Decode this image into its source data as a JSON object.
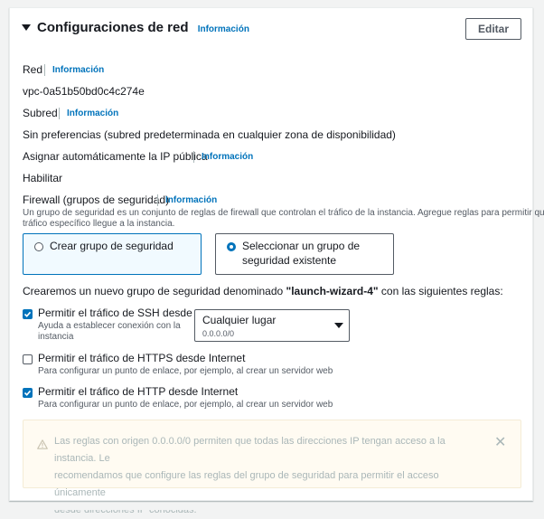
{
  "header": {
    "title": "Configuraciones de red",
    "info": "Información",
    "edit_button": "Editar"
  },
  "network": {
    "label": "Red",
    "info": "Información",
    "value": "vpc-0a51b50bd0c4c274e"
  },
  "subnet": {
    "label": "Subred",
    "info": "Información",
    "value": "Sin preferencias (subred predeterminada en cualquier zona de disponibilidad)"
  },
  "public_ip": {
    "label": "Asignar automáticamente la IP pública",
    "info": "Información",
    "value": "Habilitar"
  },
  "firewall": {
    "label": "Firewall (grupos de seguridad)",
    "info": "Información",
    "description_line1": "Un grupo de seguridad es un conjunto de reglas de firewall que controlan el tráfico de la instancia. Agregue reglas para permitir que un",
    "description_line2": "tráfico específico llegue a la instancia.",
    "option_create": "Crear grupo de seguridad",
    "option_existing_line1": "Seleccionar un grupo de",
    "option_existing_line2": "seguridad existente",
    "selected_option": "existing"
  },
  "rules": {
    "intro_before": "Crearemos un nuevo grupo de seguridad denominado ",
    "group_name": "\"launch-wizard-4\"",
    "intro_after": " con las siguientes reglas:",
    "ssh": {
      "label": "Permitir el tráfico de SSH desde",
      "help_line1": "Ayuda a establecer conexión con la",
      "help_line2": "instancia",
      "checked": true
    },
    "ssh_source": {
      "value": "Cualquier lugar",
      "sub": "0.0.0.0/0"
    },
    "https": {
      "label": "Permitir el tráfico de HTTPS desde Internet",
      "help": "Para configurar un punto de enlace, por ejemplo, al crear un servidor web",
      "checked": false
    },
    "http": {
      "label": "Permitir el tráfico de HTTP desde Internet",
      "help": "Para configurar un punto de enlace, por ejemplo, al crear un servidor web",
      "checked": true
    }
  },
  "alert": {
    "line1": "Las reglas con origen 0.0.0.0/0 permiten que todas las direcciones IP tengan acceso a la instancia. Le",
    "line2": "recomendamos que configure las reglas del grupo de seguridad para permitir el acceso únicamente",
    "line3": "desde direcciones IP conocidas.",
    "close": "✕"
  },
  "colors": {
    "link": "#0073bb",
    "selected_tile_bg": "#f1faff",
    "alert_bg": "#fffbf2"
  }
}
